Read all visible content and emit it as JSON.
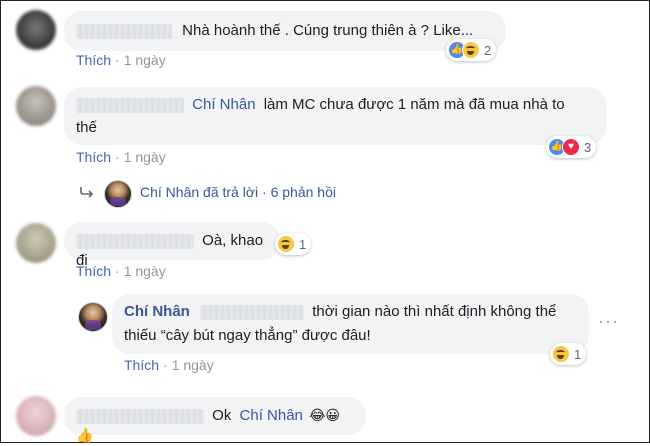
{
  "comments": [
    {
      "text": "Nhà hoành thế . Cúng trung thiên à ? Like...",
      "actions": {
        "like": "Thích",
        "time": "1 ngày"
      },
      "reactions": {
        "count": "2",
        "icons": [
          "like",
          "haha"
        ]
      }
    },
    {
      "mention": "Chí Nhân",
      "text_line1": "làm MC chưa được 1 năm mà đã mua nhà to",
      "text_line2": "thế",
      "actions": {
        "like": "Thích",
        "time": "1 ngày"
      },
      "reactions": {
        "count": "3",
        "icons": [
          "like",
          "love"
        ]
      }
    },
    {
      "text": "Oà, khao đi",
      "actions": {
        "like": "Thích",
        "time": "1 ngày"
      },
      "reactions": {
        "count": "1",
        "icons": [
          "haha"
        ]
      }
    },
    {
      "mention": "Chí Nhân",
      "emoji_text": "😂😀👍",
      "text": "Ok"
    }
  ],
  "replies_link": {
    "author": "Chí Nhân",
    "text": "Chí Nhân đã trả lời · 6 phản hồi"
  },
  "reply": {
    "author": "Chí Nhân",
    "text_line1": "thời gian nào thì nhất định không thể",
    "text_line2": "thiếu “cây bút ngay thẳng” được đâu!",
    "actions": {
      "like": "Thích",
      "time": "1 ngày"
    },
    "reactions": {
      "count": "1",
      "icons": [
        "haha"
      ]
    },
    "more": "···"
  },
  "colors": {
    "link": "#385898",
    "like_action": "#4267b2",
    "bubble": "#f2f3f5",
    "meta": "#90949c"
  }
}
